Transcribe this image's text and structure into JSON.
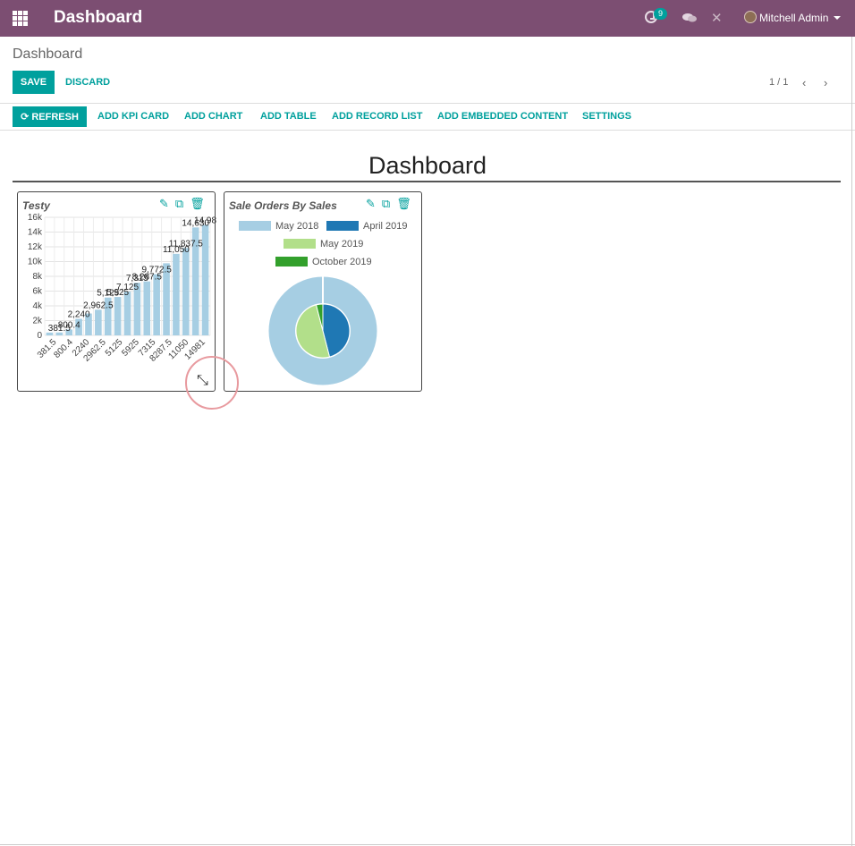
{
  "navbar": {
    "title": "Dashboard",
    "activity_count": "9",
    "user_name": "Mitchell Admin",
    "icons": [
      "apps-icon",
      "activity-icon",
      "chat-icon",
      "close-icon",
      "avatar",
      "caret-down-icon"
    ]
  },
  "control_panel": {
    "breadcrumb": "Dashboard",
    "save_label": "SAVE",
    "discard_label": "DISCARD",
    "pager": "1 / 1"
  },
  "toolbar": {
    "refresh_label": "REFRESH",
    "add_kpi_card": "ADD KPI CARD",
    "add_chart": "ADD CHART",
    "add_table": "ADD TABLE",
    "add_record_list": "ADD RECORD LIST",
    "add_embedded_content": "ADD EMBEDDED CONTENT",
    "settings": "SETTINGS"
  },
  "dashboard": {
    "title": "Dashboard"
  },
  "colors": {
    "navbar": "#7c4e72",
    "accent": "#00a09d",
    "bar": "#a6cee3"
  },
  "chart_data": [
    {
      "type": "bar",
      "title": "Testy",
      "categories": [
        "381.5",
        "800.4",
        "2240",
        "2962.5",
        "5125",
        "5925",
        "7315",
        "8287.5",
        "11050",
        "14981"
      ],
      "values": [
        381.5,
        393,
        800.4,
        2240,
        2962.5,
        3475,
        5125,
        5200,
        5925,
        7125,
        7315,
        8287.5,
        9772.5,
        11050,
        11837.5,
        14630,
        14981
      ],
      "bar_labels": [
        "381.5",
        "800.4",
        "2,240",
        "2,962.5",
        "5,125",
        "5,925",
        "7,125",
        "7,315",
        "8,287.5",
        "9,772.5",
        "11,050",
        "11,837.5",
        "14,630",
        "14,98"
      ],
      "yticks": [
        "0",
        "2k",
        "4k",
        "6k",
        "8k",
        "10k",
        "12k",
        "14k",
        "16k"
      ],
      "ylim": [
        0,
        16000
      ],
      "grid": true
    },
    {
      "type": "pie",
      "title": "Sale Orders By Sales",
      "labels": [
        "May 2018",
        "April 2019",
        "May 2019",
        "October 2019"
      ],
      "colors": [
        "#a6cee3",
        "#1f78b4",
        "#b2df8a",
        "#33a02c"
      ],
      "outer_ring_values": [
        100
      ],
      "inner_values": [
        46,
        50,
        4
      ],
      "inner_labels": [
        "April 2019",
        "May 2019",
        "October 2019"
      ],
      "legend_position": "top"
    }
  ]
}
